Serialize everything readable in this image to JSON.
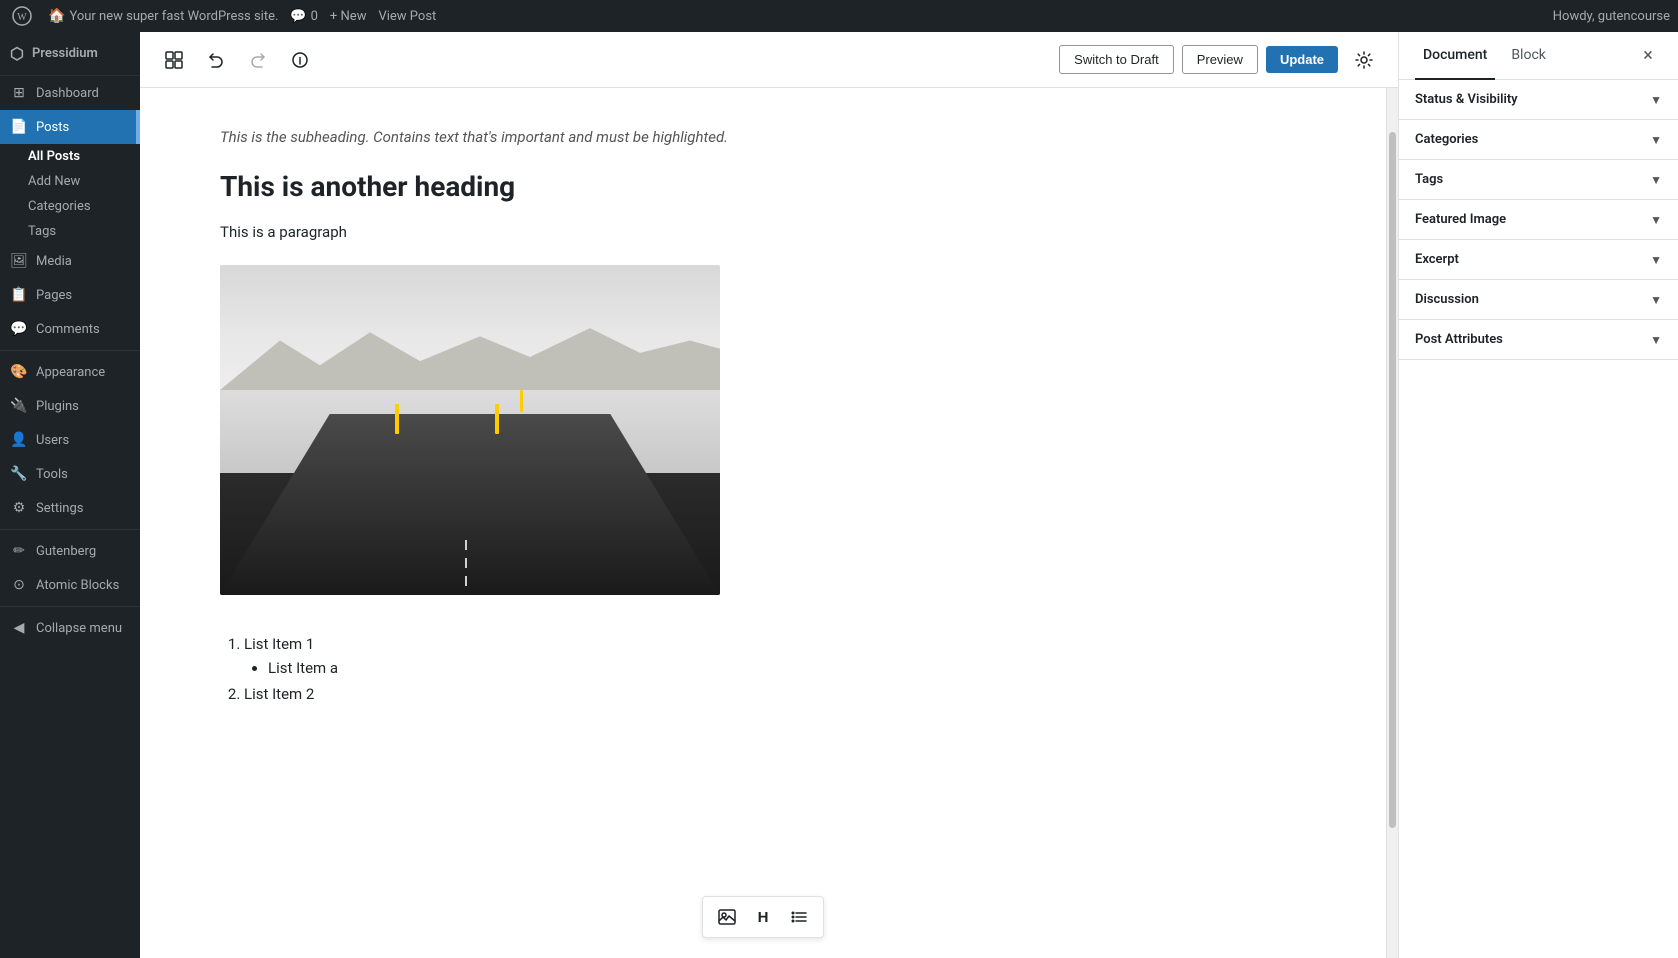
{
  "adminbar": {
    "logo_label": "WordPress",
    "site_name": "Your new super fast WordPress site.",
    "comments_label": "Comments",
    "comments_count": "0",
    "new_label": "+ New",
    "view_post_label": "View Post",
    "howdy_text": "Howdy, gutencourse"
  },
  "sidebar": {
    "brand": "Pressidium",
    "items": [
      {
        "id": "dashboard",
        "label": "Dashboard",
        "icon": "⊞"
      },
      {
        "id": "posts",
        "label": "Posts",
        "icon": "📄",
        "active": true
      },
      {
        "id": "media",
        "label": "Media",
        "icon": "🖼"
      },
      {
        "id": "pages",
        "label": "Pages",
        "icon": "📋"
      },
      {
        "id": "comments",
        "label": "Comments",
        "icon": "💬"
      },
      {
        "id": "appearance",
        "label": "Appearance",
        "icon": "🎨"
      },
      {
        "id": "plugins",
        "label": "Plugins",
        "icon": "🔌"
      },
      {
        "id": "users",
        "label": "Users",
        "icon": "👤"
      },
      {
        "id": "tools",
        "label": "Tools",
        "icon": "🔧"
      },
      {
        "id": "settings",
        "label": "Settings",
        "icon": "⚙"
      },
      {
        "id": "gutenberg",
        "label": "Gutenberg",
        "icon": "✏"
      },
      {
        "id": "atomic-blocks",
        "label": "Atomic Blocks",
        "icon": "⊙"
      }
    ],
    "submenu_posts": [
      {
        "id": "all-posts",
        "label": "All Posts",
        "active": true
      },
      {
        "id": "add-new",
        "label": "Add New"
      },
      {
        "id": "categories",
        "label": "Categories"
      },
      {
        "id": "tags",
        "label": "Tags"
      }
    ],
    "collapse_label": "Collapse menu"
  },
  "toolbar": {
    "add_block_label": "+",
    "undo_label": "Undo",
    "redo_label": "Redo",
    "info_label": "Info",
    "switch_draft_label": "Switch to Draft",
    "preview_label": "Preview",
    "update_label": "Update",
    "settings_label": "Settings"
  },
  "editor": {
    "subheading": "This is the subheading. Contains text that's important and must be highlighted.",
    "heading": "This is another heading",
    "paragraph": "This is a paragraph",
    "list_items": [
      {
        "label": "List Item 1",
        "sub_items": [
          "List Item a"
        ]
      },
      {
        "label": "List Item 2",
        "sub_items": []
      }
    ]
  },
  "right_panel": {
    "tab_document": "Document",
    "tab_block": "Block",
    "close_label": "×",
    "sections": [
      {
        "id": "status-visibility",
        "label": "Status & Visibility"
      },
      {
        "id": "categories",
        "label": "Categories"
      },
      {
        "id": "tags",
        "label": "Tags"
      },
      {
        "id": "featured-image",
        "label": "Featured Image"
      },
      {
        "id": "excerpt",
        "label": "Excerpt"
      },
      {
        "id": "discussion",
        "label": "Discussion"
      },
      {
        "id": "post-attributes",
        "label": "Post Attributes"
      }
    ]
  },
  "block_toolbar": {
    "image_icon": "🖼",
    "heading_icon": "H",
    "list_icon": "☰"
  }
}
